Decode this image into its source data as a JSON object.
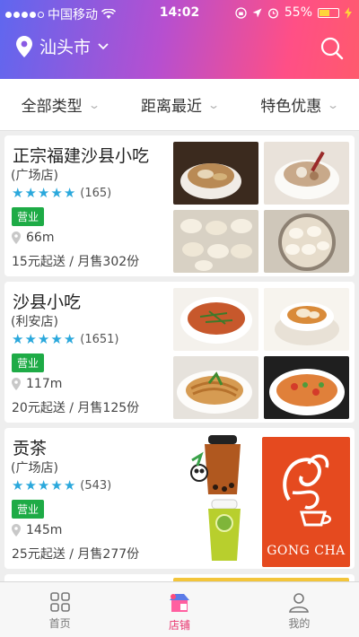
{
  "status_bar": {
    "carrier": "中国移动",
    "time": "14:02",
    "battery": "55%",
    "battery_level": 0.55
  },
  "header": {
    "city": "汕头市",
    "city_chevron": "chevron-down-icon",
    "search_icon": "search-icon"
  },
  "filters": [
    {
      "label": "全部类型"
    },
    {
      "label": "距离最近"
    },
    {
      "label": "特色优惠"
    }
  ],
  "shops": [
    {
      "name": "正宗福建沙县小吃",
      "branch": "(广场店)",
      "rating": 5,
      "review_count": "(165)",
      "status": "营业",
      "distance": "66m",
      "info": "15元起送 / 月售302份"
    },
    {
      "name": "沙县小吃",
      "branch": "(利安店)",
      "rating": 5,
      "review_count": "(1651)",
      "status": "营业",
      "distance": "117m",
      "info": "20元起送 / 月售125份"
    },
    {
      "name": "贡茶",
      "branch": "(广场店)",
      "rating": 5,
      "review_count": "(543)",
      "status": "营业",
      "distance": "145m",
      "info": "25元起送 / 月售277份",
      "logo_text": "GONG CHA"
    }
  ],
  "tabbar": {
    "tabs": [
      {
        "label": "首页",
        "icon": "grid-icon"
      },
      {
        "label": "店铺",
        "icon": "shop-icon",
        "active": true
      },
      {
        "label": "我的",
        "icon": "user-icon"
      }
    ]
  },
  "colors": {
    "header_gradient_start": "#5f67ef",
    "header_gradient_end": "#ff5a6d",
    "star": "#2aa8dc",
    "badge": "#1eab46",
    "active_tab": "#e8336e",
    "gongcha_brand": "#e54a1f"
  }
}
